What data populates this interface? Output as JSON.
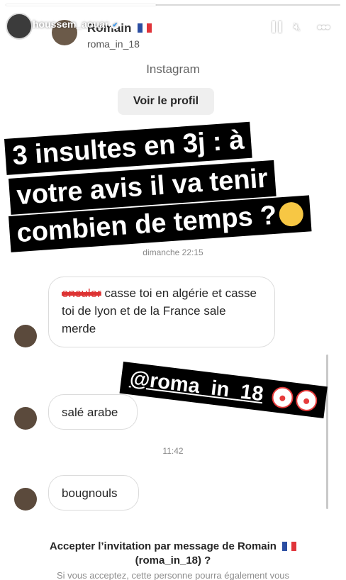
{
  "story": {
    "progress_fraction": 0.45,
    "poster_name": "houssem_aouar",
    "icons": {
      "pause": "pause-icon",
      "mute": "mute-icon",
      "more": "more-icon",
      "verified": "verified-badge-icon"
    }
  },
  "dm": {
    "contact_name": "Romain",
    "contact_handle": "roma_in_18",
    "platform_label": "Instagram",
    "view_profile_label": "Voir le profil",
    "timestamp_1": "dimanche 22:15",
    "timestamp_2": "11:42",
    "messages": [
      {
        "struck_word": "enculer",
        "text": "casse toi en algérie et casse toi de lyon et de la France sale merde"
      },
      {
        "text": "salé arabe"
      },
      {
        "text": "bougnouls"
      }
    ]
  },
  "captions": {
    "line1": "3 insultes en 3j : à",
    "line2": "votre avis il va tenir",
    "line3": "combien de temps ?",
    "mention": "@roma_in_18"
  },
  "accept": {
    "title": "Accepter l’invitation par message de Romain",
    "handle": "(roma_in_18) ?",
    "subtitle": "Si vous acceptez, cette personne pourra également vous"
  },
  "colors": {
    "flag_blue": "#2b4ea2",
    "flag_white": "#ffffff",
    "flag_red": "#e0343a",
    "strike": "#dd3333"
  }
}
